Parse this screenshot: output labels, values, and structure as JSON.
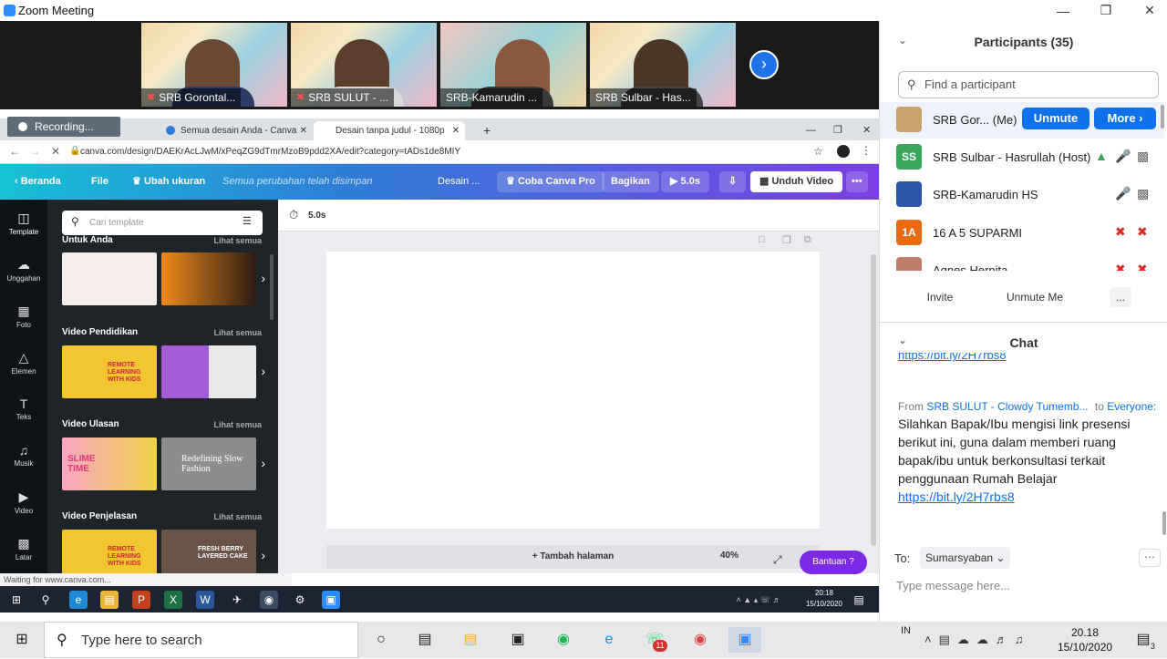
{
  "zoom": {
    "window_title": "Zoom Meeting",
    "videos": [
      {
        "name": "SRB Gorontal...",
        "muted": true
      },
      {
        "name": "SRB SULUT - ...",
        "muted": true
      },
      {
        "name": "SRB-Kamarudin ...",
        "muted": false
      },
      {
        "name": "SRB Sulbar - Has...",
        "muted": false
      }
    ],
    "recording_label": "Recording..."
  },
  "browser": {
    "tabs": [
      {
        "label": "Semua desain Anda - Canva"
      },
      {
        "label": "Desain tanpa judul - 1080p"
      }
    ],
    "url": "canva.com/design/DAEKrAcLJwM/xPeqZG9dTmrMzoB9pdd2XA/edit?category=tADs1de8MIY",
    "status": "Waiting for www.canva.com..."
  },
  "canva": {
    "top": {
      "home": "Beranda",
      "file": "File",
      "resize": "Ubah ukuran",
      "saved": "Semua perubahan telah disimpan",
      "design": "Desain ...",
      "pro": "Coba Canva Pro",
      "share": "Bagikan",
      "play": "5.0s",
      "download": "Unduh Video"
    },
    "rail": [
      "Template",
      "Unggahan",
      "Foto",
      "Elemen",
      "Teks",
      "Musik",
      "Video",
      "Latar"
    ],
    "search_placeholder": "Cari template",
    "sections": [
      {
        "title": "Untuk Anda",
        "more": "Lihat semua"
      },
      {
        "title": "Video Pendidikan",
        "more": "Lihat semua"
      },
      {
        "title": "Video Ulasan",
        "more": "Lihat semua"
      },
      {
        "title": "Video Penjelasan",
        "more": "Lihat semua"
      }
    ],
    "thumb_text": {
      "remote": "REMOTE LEARNING WITH KIDS",
      "slime": "SLIME TIME",
      "fashion": "Redefining Slow Fashion",
      "cake": "FRESH BERRY LAYERED CAKE"
    },
    "timer": "5.0s",
    "add_page": "+ Tambah halaman",
    "zoom": "40%",
    "help": "Bantuan ?"
  },
  "panel": {
    "participants_title": "Participants (35)",
    "find_placeholder": "Find a participant",
    "participants": [
      {
        "initials": "",
        "name": "SRB Gor...  (Me)",
        "color": "#c9a36b"
      },
      {
        "initials": "SS",
        "name": "SRB Sulbar - Hasrullah (Host)",
        "color": "#3aa55b"
      },
      {
        "initials": "",
        "name": "SRB-Kamarudin HS",
        "color": "#2a56a8"
      },
      {
        "initials": "1A",
        "name": "16 A 5 SUPARMI",
        "color": "#ea6a12"
      },
      {
        "initials": "",
        "name": "Agnes Hernita",
        "color": "#c07e6a"
      }
    ],
    "unmute": "Unmute",
    "more": "More",
    "invite": "Invite",
    "unmute_me": "Unmute Me",
    "dots": "...",
    "chat_title": "Chat",
    "chat_link_partial": "https://bit.ly/2H7rbs8",
    "chat_from_label": "From",
    "chat_from": "SRB SULUT - Clowdy Tumemb...",
    "chat_to_label": "to",
    "chat_to": "Everyone:",
    "chat_message": "Silahkan Bapak/Ibu mengisi link presensi berikut ini, guna dalam memberi ruang bapak/ibu untuk berkonsultasi terkait penggunaan Rumah Belajar",
    "chat_link": "https://bit.ly/2H7rbs8",
    "to_label": "To:",
    "to_value": "Sumarsyaban",
    "input_placeholder": "Type message here..."
  },
  "taskbar": {
    "search_placeholder": "Type here to search",
    "lang": "IN",
    "time": "20.18",
    "date": "15/10/2020",
    "whatsapp_badge": "11",
    "notif_count": "3",
    "inner_time": "20:18",
    "inner_date": "15/10/2020"
  },
  "colors": {
    "zoom_blue": "#0e72ed",
    "canva_purple": "#7d2ae8",
    "teal": "#16c2d5"
  }
}
